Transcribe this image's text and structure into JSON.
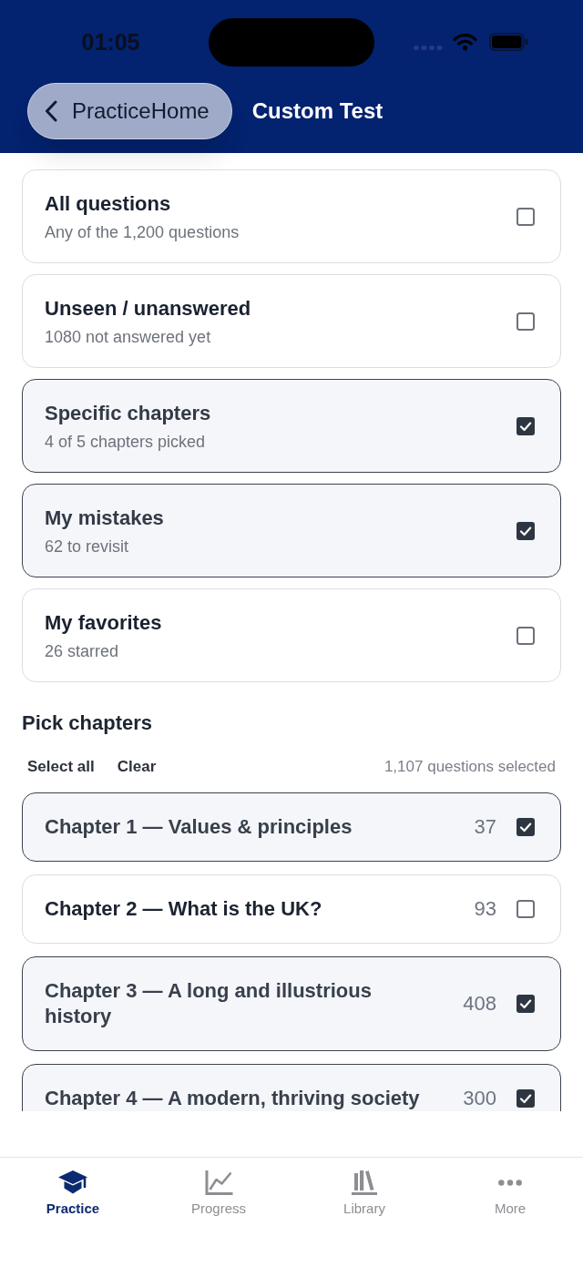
{
  "status_bar": {
    "time": "01:05"
  },
  "nav_bar": {
    "back_button": "PracticeHome",
    "title": "Custom Test"
  },
  "options": [
    {
      "title": "All questions",
      "subtitle": "Any of the 1,200 questions",
      "checked": false
    },
    {
      "title": "Unseen / unanswered",
      "subtitle": "1080 not answered yet",
      "checked": false
    },
    {
      "title": "Specific chapters",
      "subtitle": "4 of 5 chapters picked",
      "checked": true
    },
    {
      "title": "My mistakes",
      "subtitle": "62 to revisit",
      "checked": true
    },
    {
      "title": "My favorites",
      "subtitle": "26 starred",
      "checked": false
    }
  ],
  "chapter_picker": {
    "heading": "Pick chapters",
    "actions": [
      "Select all",
      "Clear"
    ],
    "summary": "1,107 questions selected",
    "chapters": [
      {
        "title": "Chapter 1 — Values & principles",
        "count": "37",
        "checked": true
      },
      {
        "title": "Chapter 2 — What is the UK?",
        "count": "93",
        "checked": false
      },
      {
        "title": "Chapter 3 — A long and illustrious history",
        "count": "408",
        "checked": true
      },
      {
        "title": "Chapter 4 — A modern, thriving society",
        "count": "300",
        "checked": true
      }
    ]
  },
  "tab_bar": [
    {
      "label": "Practice",
      "selected": true
    },
    {
      "label": "Progress",
      "selected": false
    },
    {
      "label": "Library",
      "selected": false
    },
    {
      "label": "More",
      "selected": false
    }
  ]
}
